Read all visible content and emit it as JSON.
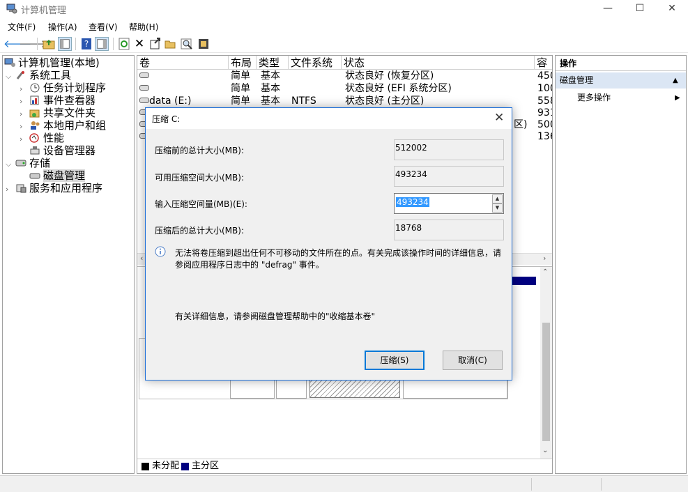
{
  "window": {
    "title": "计算机管理",
    "minimize_glyph": "—",
    "maximize_glyph": "☐",
    "close_glyph": "✕"
  },
  "menu": {
    "items": [
      "文件(F)",
      "操作(A)",
      "查看(V)",
      "帮助(H)"
    ]
  },
  "toolbar": {
    "icons": [
      "back-icon",
      "forward-icon",
      "up-folder-icon",
      "show-hide-tree-icon",
      "help-icon",
      "properties-icon",
      "refresh-icon",
      "delete-icon",
      "export-icon",
      "open-folder-icon",
      "search-icon",
      "settings-icon"
    ]
  },
  "tree": {
    "root": "计算机管理(本地)",
    "system_tools": "系统工具",
    "task_scheduler": "任务计划程序",
    "event_viewer": "事件查看器",
    "shared_folders": "共享文件夹",
    "local_users": "本地用户和组",
    "performance": "性能",
    "device_manager": "设备管理器",
    "storage": "存储",
    "disk_management": "磁盘管理",
    "services_apps": "服务和应用程序"
  },
  "volumes": {
    "headers": [
      "卷",
      "布局",
      "类型",
      "文件系统",
      "状态",
      "容"
    ],
    "rows": [
      {
        "vol": "",
        "layout": "简单",
        "type": "基本",
        "fs": "",
        "status": "状态良好 (恢复分区)",
        "cap": "450"
      },
      {
        "vol": "",
        "layout": "简单",
        "type": "基本",
        "fs": "",
        "status": "状态良好 (EFI 系统分区)",
        "cap": "100"
      },
      {
        "vol": "data (E:)",
        "layout": "简单",
        "type": "基本",
        "fs": "NTFS",
        "status": "状态良好 (主分区)",
        "cap": "558"
      },
      {
        "vol": "",
        "layout": "",
        "type": "",
        "fs": "",
        "status": "",
        "cap": "931"
      },
      {
        "vol": "",
        "layout": "",
        "type": "",
        "fs": "",
        "status": "区)",
        "cap": "500"
      },
      {
        "vol": "",
        "layout": "",
        "type": "",
        "fs": "",
        "status": "",
        "cap": "136"
      }
    ]
  },
  "legend": {
    "unallocated": "未分配",
    "primary": "主分区",
    "unallocated_color": "#000000",
    "primary_color": "#000080"
  },
  "actions": {
    "header": "操作",
    "section": "磁盘管理",
    "more": "更多操作"
  },
  "dialog": {
    "title": "压缩 C:",
    "total_before_label": "压缩前的总计大小(MB):",
    "total_before_value": "512002",
    "available_label": "可用压缩空间大小(MB):",
    "available_value": "493234",
    "input_label": "输入压缩空间量(MB)(E):",
    "input_value": "493234",
    "total_after_label": "压缩后的总计大小(MB):",
    "total_after_value": "18768",
    "info_text_1": "无法将卷压缩到超出任何不可移动的文件所在的点。有关完成该操作时间的详细信息，请",
    "info_text_2": "参阅应用程序日志中的 \"defrag\" 事件。",
    "help_text": "有关详细信息，请参阅磁盘管理帮助中的\"收缩基本卷\"",
    "shrink_button": "压缩(S)",
    "cancel_button": "取消(C)"
  }
}
